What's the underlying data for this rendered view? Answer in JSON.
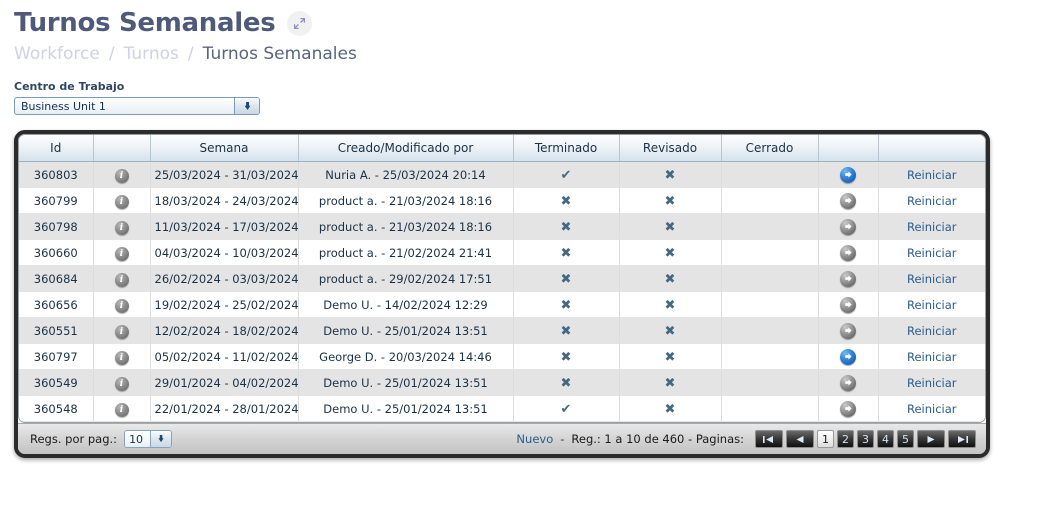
{
  "header": {
    "title": "Turnos Semanales",
    "expand_icon": "expand-diagonal-icon",
    "breadcrumb": [
      {
        "label": "Workforce",
        "current": false
      },
      {
        "label": "Turnos",
        "current": false
      },
      {
        "label": "Turnos Semanales",
        "current": true
      }
    ],
    "separator": "/"
  },
  "filter": {
    "label": "Centro de Trabajo",
    "value": "Business Unit 1",
    "arrow_icon": "chevron-down-icon"
  },
  "grid": {
    "columns": [
      {
        "key": "id",
        "label": "Id"
      },
      {
        "key": "info",
        "label": ""
      },
      {
        "key": "semana",
        "label": "Semana"
      },
      {
        "key": "autor",
        "label": "Creado/Modificado por"
      },
      {
        "key": "terminado",
        "label": "Terminado"
      },
      {
        "key": "revisado",
        "label": "Revisado"
      },
      {
        "key": "cerrado",
        "label": "Cerrado"
      },
      {
        "key": "goto",
        "label": ""
      },
      {
        "key": "action",
        "label": ""
      }
    ],
    "info_icon": "info-circle-icon",
    "goto_icon": "arrow-right-circle-icon",
    "check_glyph": "✔",
    "cross_glyph": "✖",
    "action_label": "Reiniciar",
    "rows": [
      {
        "id": "360803",
        "semana": "25/03/2024 - 31/03/2024",
        "autor": "Nuria A. - 25/03/2024 20:14",
        "terminado": "check",
        "revisado": "cross",
        "cerrado": "",
        "goto_color": "blue",
        "action": "Reiniciar"
      },
      {
        "id": "360799",
        "semana": "18/03/2024 - 24/03/2024",
        "autor": "product a. - 21/03/2024 18:16",
        "terminado": "cross",
        "revisado": "cross",
        "cerrado": "",
        "goto_color": "gray",
        "action": "Reiniciar"
      },
      {
        "id": "360798",
        "semana": "11/03/2024 - 17/03/2024",
        "autor": "product a. - 21/03/2024 18:16",
        "terminado": "cross",
        "revisado": "cross",
        "cerrado": "",
        "goto_color": "gray",
        "action": "Reiniciar"
      },
      {
        "id": "360660",
        "semana": "04/03/2024 - 10/03/2024",
        "autor": "product a. - 21/02/2024 21:41",
        "terminado": "cross",
        "revisado": "cross",
        "cerrado": "",
        "goto_color": "gray",
        "action": "Reiniciar"
      },
      {
        "id": "360684",
        "semana": "26/02/2024 - 03/03/2024",
        "autor": "product a. - 29/02/2024 17:51",
        "terminado": "cross",
        "revisado": "cross",
        "cerrado": "",
        "goto_color": "gray",
        "action": "Reiniciar"
      },
      {
        "id": "360656",
        "semana": "19/02/2024 - 25/02/2024",
        "autor": "Demo U. - 14/02/2024 12:29",
        "terminado": "cross",
        "revisado": "cross",
        "cerrado": "",
        "goto_color": "gray",
        "action": "Reiniciar"
      },
      {
        "id": "360551",
        "semana": "12/02/2024 - 18/02/2024",
        "autor": "Demo U. - 25/01/2024 13:51",
        "terminado": "cross",
        "revisado": "cross",
        "cerrado": "",
        "goto_color": "gray",
        "action": "Reiniciar"
      },
      {
        "id": "360797",
        "semana": "05/02/2024 - 11/02/2024",
        "autor": "George D. - 20/03/2024 14:46",
        "terminado": "cross",
        "revisado": "cross",
        "cerrado": "",
        "goto_color": "blue",
        "action": "Reiniciar"
      },
      {
        "id": "360549",
        "semana": "29/01/2024 - 04/02/2024",
        "autor": "Demo U. - 25/01/2024 13:51",
        "terminado": "cross",
        "revisado": "cross",
        "cerrado": "",
        "goto_color": "gray",
        "action": "Reiniciar"
      },
      {
        "id": "360548",
        "semana": "22/01/2024 - 28/01/2024",
        "autor": "Demo U. - 25/01/2024 13:51",
        "terminado": "check",
        "revisado": "cross",
        "cerrado": "",
        "goto_color": "gray",
        "action": "Reiniciar"
      }
    ]
  },
  "footer": {
    "per_page_label": "Regs. por pag.:",
    "per_page_value": "10",
    "new_label": "Nuevo",
    "dash": "-",
    "records_text": "Reg.: 1 a 10 de 460 - Paginas:",
    "pages": [
      {
        "label": "1",
        "selected": true
      },
      {
        "label": "2",
        "selected": false
      },
      {
        "label": "3",
        "selected": false
      },
      {
        "label": "4",
        "selected": false
      },
      {
        "label": "5",
        "selected": false
      }
    ],
    "nav": {
      "first_icon": "first-page-icon",
      "prev_icon": "prev-page-icon",
      "next_icon": "next-page-icon",
      "last_icon": "last-page-icon"
    }
  },
  "colors": {
    "title": "#4f5a7a",
    "breadcrumb_inactive": "#cdd2e4",
    "link": "#2a5c8a",
    "mark": "#45697f",
    "arrow_blue": "#2a7fd4",
    "row_odd": "#e4e4e4"
  }
}
